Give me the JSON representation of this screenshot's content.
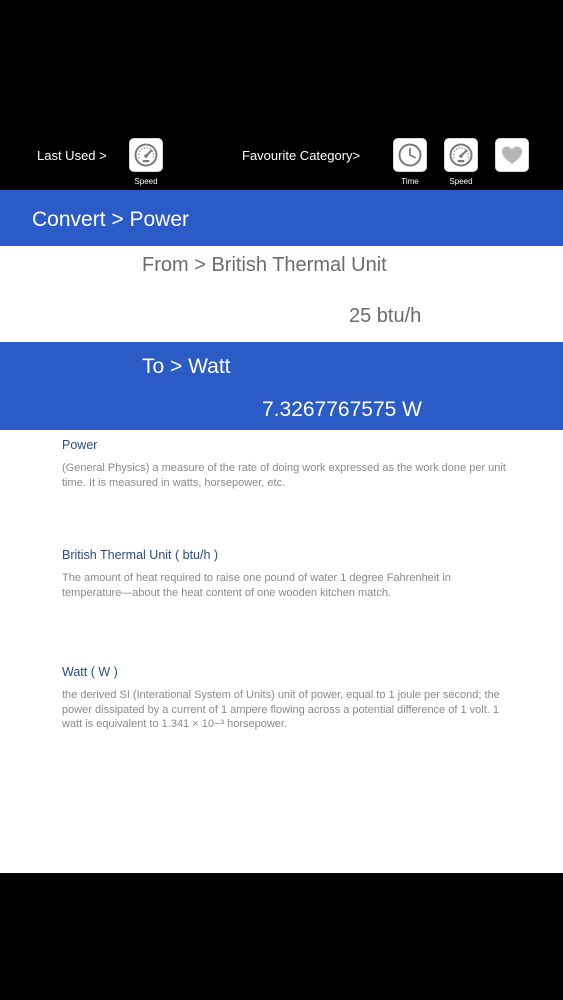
{
  "toolbar": {
    "last_used_label": "Last Used >",
    "last_used_items": [
      {
        "label": "Speed",
        "icon": "speedometer-icon"
      }
    ],
    "favourite_label": "Favourite Category>",
    "favourite_items": [
      {
        "label": "Time",
        "icon": "clock-icon"
      },
      {
        "label": "Speed",
        "icon": "speedometer-icon"
      }
    ],
    "favourite_toggle_icon": "heart-icon"
  },
  "converter": {
    "title": "Convert > Power",
    "from_label": "From > British Thermal Unit",
    "from_value": "25 btu/h",
    "to_label": "To > Watt",
    "to_value": "7.3267767575 W"
  },
  "definitions": [
    {
      "title": "Power",
      "body": " (General Physics) a measure of the rate of doing work expressed as the work done per unit time. It is measured in watts, horsepower, etc."
    },
    {
      "title": "British Thermal Unit ( btu/h )",
      "body": "The amount of heat required to raise one pound of water 1 degree Fahrenheit in temperature—about the heat content of one wooden kitchen match."
    },
    {
      "title": "Watt ( W )",
      "body": "the derived SI (Interational System of Units) unit of power, equal to 1 joule per second; the power dissipated by a current of 1 ampere flowing across a potential difference of 1 volt. 1 watt is equivalent to 1.341 × 10−³ horsepower."
    }
  ],
  "colors": {
    "accent_blue": "#2a5bc7",
    "background": "#000000",
    "panel": "#ffffff",
    "definition_title": "#2b4a8a",
    "definition_body": "#8a8a8a"
  }
}
